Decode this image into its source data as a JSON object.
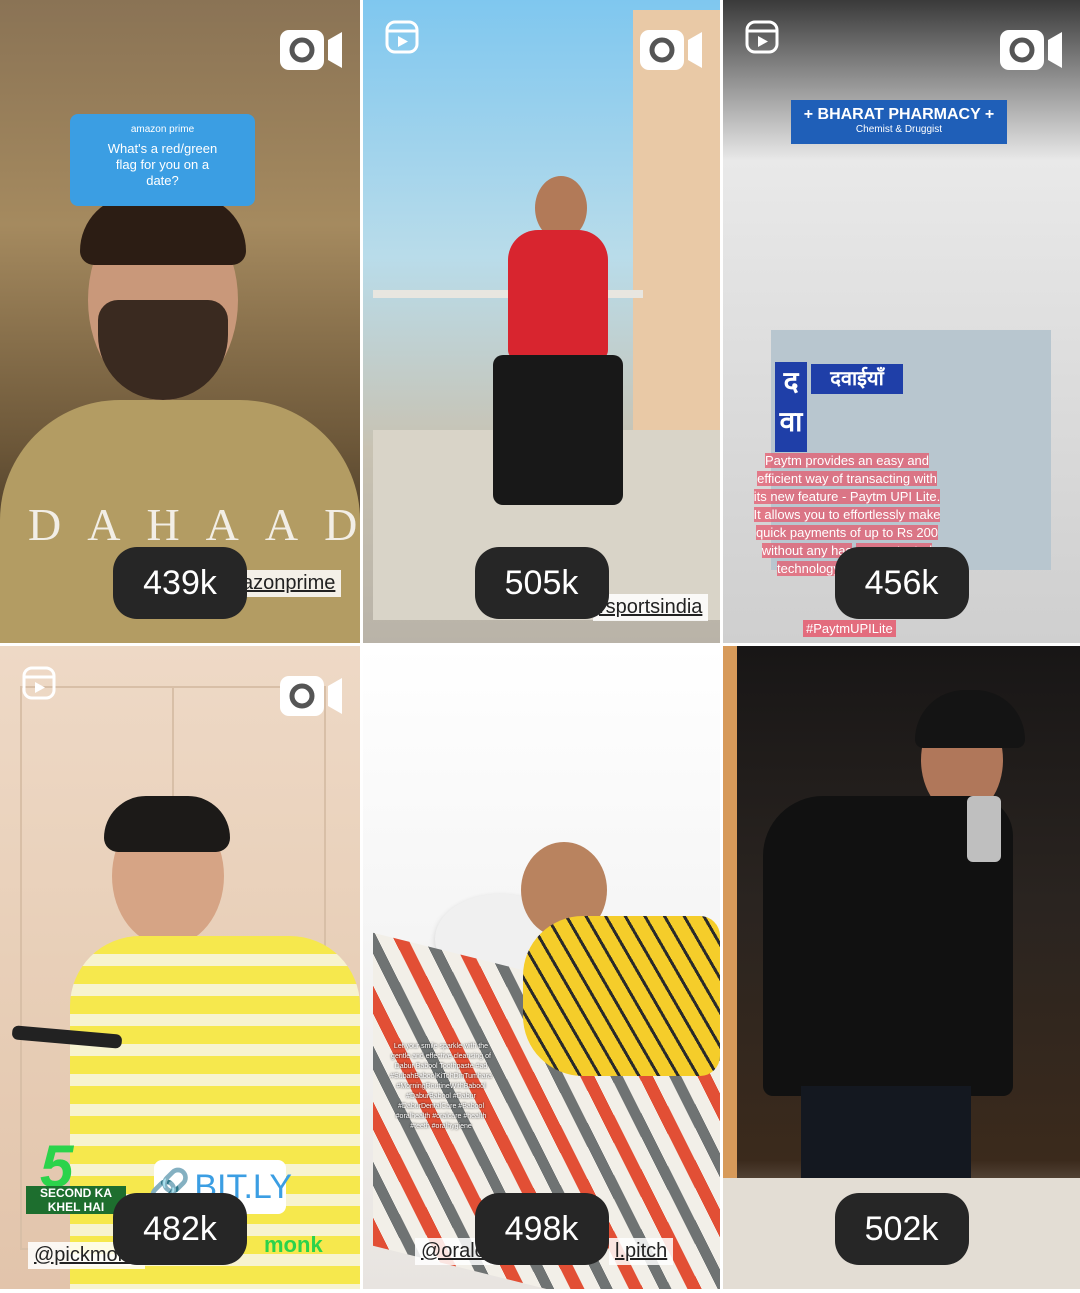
{
  "tiles": [
    {
      "views": "439k",
      "sticker": {
        "brand": "amazon prime",
        "question": "What's a red/green flag for you on a date?"
      },
      "title_overlay": "DAHAAD",
      "mention": "azonprime"
    },
    {
      "views": "505k",
      "mention": "rsportsindia"
    },
    {
      "views": "456k",
      "sign_title": "+ BHARAT PHARMACY +",
      "sign_sub": "Chemist & Druggist",
      "shop_sign": "दवाईयाँ",
      "shop_sign_left": "द वा",
      "caption": "Paytm provides an easy and efficient way of transacting with its new feature - Paytm UPI Lite. It allows you to effortlessly make quick payments of up to Rs 200 without any has",
      "caption_tail": "are protected technology, compromise",
      "hashtag": "#PaytmUPILite"
    },
    {
      "views": "482k",
      "logo_number": "5",
      "logo_text": "SECOND KA KHEL HAI",
      "link_sticker": "BIT.LY",
      "mention": "@pickmonk",
      "brand_logo": "monk"
    },
    {
      "views": "498k",
      "caption": "Let your smile sparkle with the gentle and effective cleansing of Dabur Babool Toothpaste #ad #SubahBaboolKiTohDinTumhara #MorningRoutineWithBabool #DaburBabool #Dabur #DaburDentalCare #Babool #oralhealth #oralcare #health #teeth #oralhygiene",
      "mention_left": "@oralca",
      "mention_right": "l.pitch"
    },
    {
      "views": "502k"
    }
  ],
  "colors": {
    "pill_bg": "#262626",
    "pill_text": "#ffffff"
  },
  "icons": [
    "video-camera-icon",
    "reels-icon"
  ]
}
